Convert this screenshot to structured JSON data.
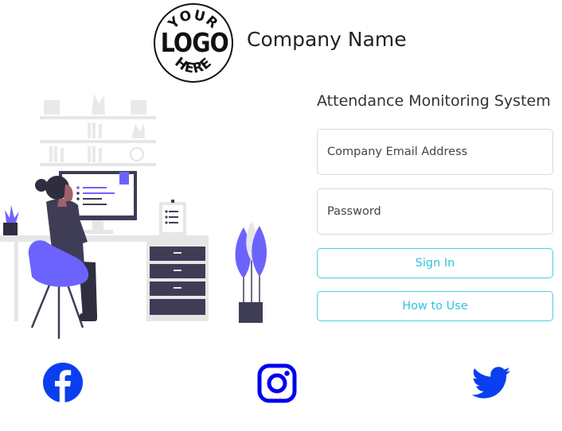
{
  "header": {
    "logo": {
      "line1": "YOUR",
      "line2": "LOGO",
      "line3": "HERE"
    },
    "company_name": "Company Name"
  },
  "login": {
    "title": "Attendance Monitoring System",
    "email_placeholder": "Company Email Address",
    "password_placeholder": "Password",
    "sign_in_label": "Sign In",
    "how_to_use_label": "How to Use"
  },
  "social": {
    "items": [
      {
        "icon": "facebook-icon",
        "color": "#0a3ff0"
      },
      {
        "icon": "instagram-icon",
        "color": "#0000ee"
      },
      {
        "icon": "twitter-icon",
        "color": "#0a3ff0"
      }
    ]
  },
  "colors": {
    "accent": "#6c63ff",
    "button_border": "#48d1e6",
    "button_text": "#2fc4dc",
    "social_blue": "#0a3ff0"
  }
}
